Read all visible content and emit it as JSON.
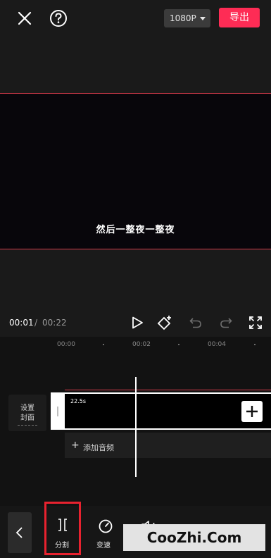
{
  "header": {
    "resolution": "1080P",
    "export_label": "导出"
  },
  "preview": {
    "subtitle": "然后一整夜一整夜"
  },
  "playback": {
    "current_time": "00:01",
    "separator": "/",
    "total_time": "00:22"
  },
  "timeline": {
    "ruler_labels": [
      "00:00",
      "00:02",
      "00:04"
    ],
    "cover": {
      "line1": "设置",
      "line2": "封面"
    },
    "clip_duration": "22.5s",
    "add_audio_label": "添加音频"
  },
  "toolbar": {
    "split_label": "分割",
    "speed_label": "变速",
    "volume_label": "音量"
  },
  "watermark": "CooZhi.Com",
  "colors": {
    "accent": "#fe2c55",
    "highlight": "#e8222f"
  }
}
